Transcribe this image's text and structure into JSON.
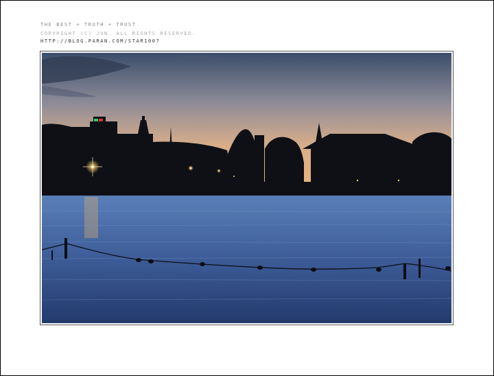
{
  "captions": {
    "line1": "the best + truth + trust",
    "line2": "copyright (c) jun. all rights reserved.",
    "line3": "http://blog.paran.com/star1007"
  },
  "photo": {
    "subject": "lake-at-dusk",
    "colors": {
      "sky_top": "#3b4d6a",
      "sky_mid": "#c7a98e",
      "sky_horizon": "#f2b27a",
      "silhouette": "#0e1016",
      "water_light": "#5a7fb8",
      "water_dark": "#233a6c",
      "lights": "#ffcf6a"
    }
  }
}
